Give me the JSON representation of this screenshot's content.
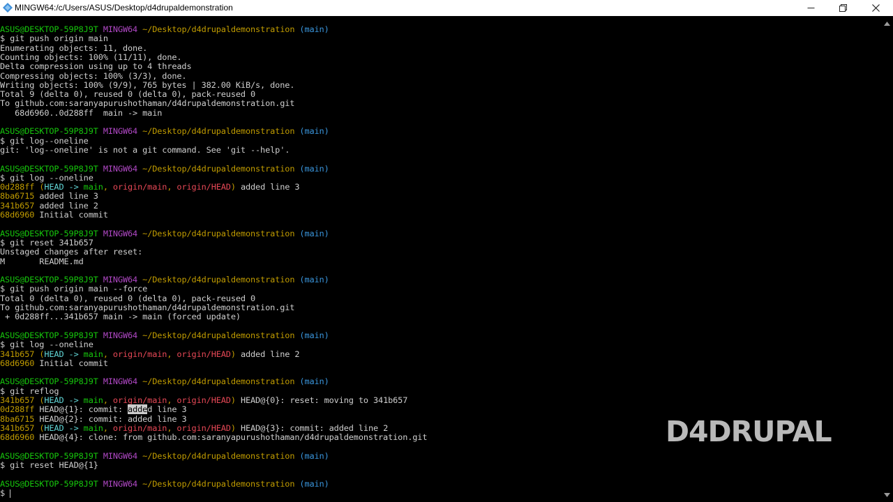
{
  "window": {
    "title": "MINGW64:/c/Users/ASUS/Desktop/d4drupaldemonstration",
    "icon": "mingw-terminal-icon"
  },
  "prompt": {
    "user_host": "ASUS@DESKTOP-59P8J9T",
    "shell": "MINGW64",
    "path": "~/Desktop/d4drupaldemonstration",
    "branch": "(main)"
  },
  "output": {
    "b1": {
      "cmd": "$ git push origin main",
      "l1": "Enumerating objects: 11, done.",
      "l2": "Counting objects: 100% (11/11), done.",
      "l3": "Delta compression using up to 4 threads",
      "l4": "Compressing objects: 100% (3/3), done.",
      "l5": "Writing objects: 100% (9/9), 765 bytes | 382.00 KiB/s, done.",
      "l6": "Total 9 (delta 0), reused 0 (delta 0), pack-reused 0",
      "l7": "To github.com:saranyapurushothaman/d4drupaldemonstration.git",
      "l8": "   68d6960..0d288ff  main -> main"
    },
    "b2": {
      "cmd": "$ git log--oneline",
      "l1": "git: 'log--oneline' is not a git command. See 'git --help'."
    },
    "b3": {
      "cmd": "$ git log --oneline",
      "r1_hash": "0d288ff",
      "r1_msg": " added line 3",
      "r2_hash": "8ba6715",
      "r2_msg": " added line 3",
      "r3_hash": "341b657",
      "r3_msg": " added line 2",
      "r4_hash": "68d6960",
      "r4_msg": " Initial commit"
    },
    "b4": {
      "cmd": "$ git reset 341b657",
      "l1": "Unstaged changes after reset:",
      "l2": "M       README.md"
    },
    "b5": {
      "cmd": "$ git push origin main --force",
      "l1": "Total 0 (delta 0), reused 0 (delta 0), pack-reused 0",
      "l2": "To github.com:saranyapurushothaman/d4drupaldemonstration.git",
      "l3": " + 0d288ff...341b657 main -> main (forced update)"
    },
    "b6": {
      "cmd": "$ git log --oneline",
      "r1_hash": "341b657",
      "r1_msg": " added line 2",
      "r2_hash": "68d6960",
      "r2_msg": " Initial commit"
    },
    "b7": {
      "cmd": "$ git reflog",
      "r1_hash": "341b657",
      "r1_msg": " HEAD@{0}: reset: moving to 341b657",
      "r2_hash": "0d288ff",
      "r2_pre": " HEAD@{1}: commit: ",
      "r2_sel": "adde",
      "r2_post": "d line 3",
      "r3_hash": "8ba6715",
      "r3_msg": " HEAD@{2}: commit: added line 3",
      "r4_hash": "341b657",
      "r4_msg": " HEAD@{3}: commit: added line 2",
      "r5_hash": "68d6960",
      "r5_msg": " HEAD@{4}: clone: from github.com:saranyapurushothaman/d4drupaldemonstration.git"
    },
    "b8": {
      "cmd": "$ git reset HEAD@{1}"
    },
    "final_prompt": "$ "
  },
  "refs": {
    "open": " (",
    "head": "HEAD -> ",
    "main": "main",
    "sep": ", ",
    "origin_main": "origin/main",
    "origin_head": "origin/HEAD",
    "close": ")"
  },
  "watermark": "D4DRUPAL",
  "colors": {
    "user_host": "#16c60c",
    "shell": "#b148c6",
    "path": "#c19c00",
    "branch": "#3a96dd",
    "hash": "#c19c00",
    "head": "#61d6d6",
    "local_branch": "#16c60c",
    "remote_branch": "#e74856"
  }
}
